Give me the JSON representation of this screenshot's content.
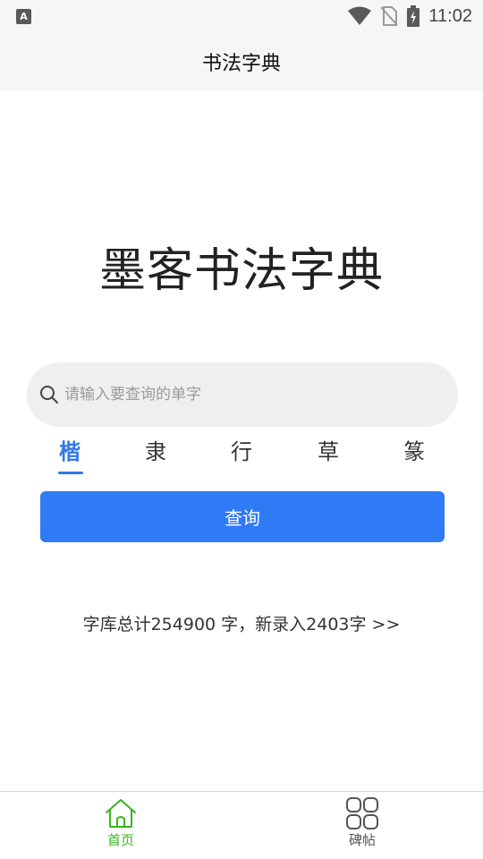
{
  "status_bar": {
    "left_badge": "A",
    "time": "11:02"
  },
  "app_bar": {
    "title": "书法字典"
  },
  "hero": {
    "title": "墨客书法字典"
  },
  "search": {
    "placeholder": "请输入要查询的单字",
    "value": ""
  },
  "styles": {
    "items": [
      "楷",
      "隶",
      "行",
      "草",
      "篆"
    ],
    "selected": "楷"
  },
  "query_button": {
    "label": "查询"
  },
  "stats": {
    "text": "字库总计254900 字，新录入2403字 >>"
  },
  "bottom_nav": {
    "items": [
      {
        "label": "首页",
        "icon": "home-icon",
        "active": true
      },
      {
        "label": "碑帖",
        "icon": "grid-icon",
        "active": false
      }
    ]
  },
  "colors": {
    "accent": "#2f7af5",
    "nav_active": "#3ab520"
  }
}
